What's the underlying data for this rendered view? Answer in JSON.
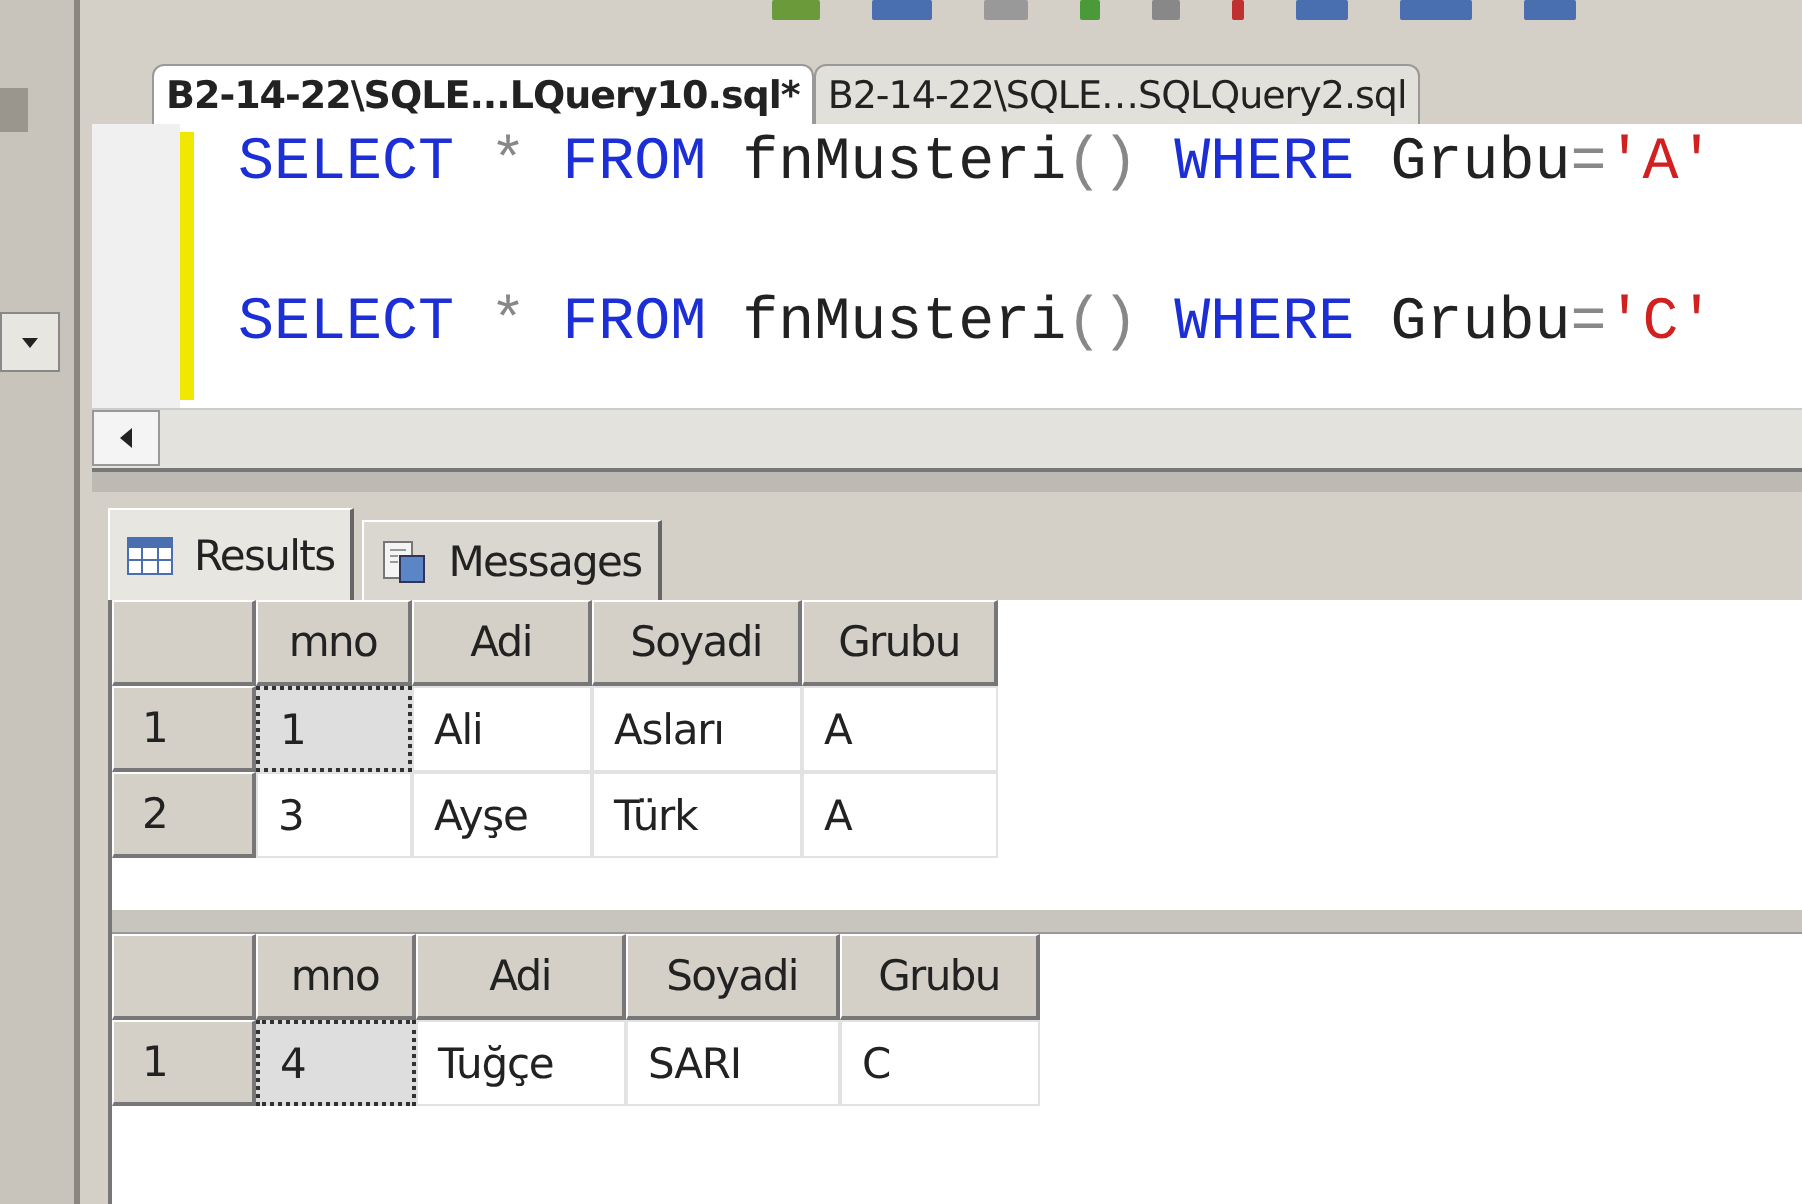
{
  "document_tabs": [
    {
      "label": "B2-14-22\\SQLE...LQuery10.sql*",
      "selected": true
    },
    {
      "label": "B2-14-22\\SQLE…SQLQuery2.sql",
      "selected": false
    }
  ],
  "editor": {
    "lines": [
      {
        "words": [
          {
            "parts": [
              {
                "kind": "keyword",
                "text": "SELECT"
              }
            ]
          },
          {
            "parts": [
              {
                "kind": "operator",
                "text": "*"
              }
            ]
          },
          {
            "parts": [
              {
                "kind": "keyword",
                "text": "FROM"
              }
            ]
          },
          {
            "parts": [
              {
                "kind": "plain",
                "text": "fnMusteri"
              },
              {
                "kind": "operator",
                "text": "()"
              }
            ]
          },
          {
            "parts": [
              {
                "kind": "keyword",
                "text": "WHERE"
              }
            ]
          },
          {
            "parts": [
              {
                "kind": "plain",
                "text": "Grubu"
              },
              {
                "kind": "operator",
                "text": "="
              },
              {
                "kind": "string",
                "text": "'A'"
              }
            ]
          }
        ]
      },
      {
        "words": [
          {
            "parts": [
              {
                "kind": "keyword",
                "text": "SELECT"
              }
            ]
          },
          {
            "parts": [
              {
                "kind": "operator",
                "text": "*"
              }
            ]
          },
          {
            "parts": [
              {
                "kind": "keyword",
                "text": "FROM"
              }
            ]
          },
          {
            "parts": [
              {
                "kind": "plain",
                "text": "fnMusteri"
              },
              {
                "kind": "operator",
                "text": "()"
              }
            ]
          },
          {
            "parts": [
              {
                "kind": "keyword",
                "text": "WHERE"
              }
            ]
          },
          {
            "parts": [
              {
                "kind": "plain",
                "text": "Grubu"
              },
              {
                "kind": "operator",
                "text": "="
              },
              {
                "kind": "string",
                "text": "'C'"
              }
            ]
          }
        ]
      }
    ]
  },
  "result_tabs": [
    {
      "label": "Results",
      "kind": "grid",
      "selected": true
    },
    {
      "label": "Messages",
      "kind": "messages",
      "selected": false
    }
  ],
  "result_sets": [
    {
      "columns": [
        "mno",
        "Adi",
        "Soyadi",
        "Grubu"
      ],
      "rows": [
        {
          "number": "1",
          "cells": [
            {
              "text": "1",
              "selected": true
            },
            {
              "text": "Ali",
              "selected": false
            },
            {
              "text": "Asları",
              "selected": false
            },
            {
              "text": "A",
              "selected": false
            }
          ]
        },
        {
          "number": "2",
          "cells": [
            {
              "text": "3",
              "selected": false
            },
            {
              "text": "Ayşe",
              "selected": false
            },
            {
              "text": "Türk",
              "selected": false
            },
            {
              "text": "A",
              "selected": false
            }
          ]
        }
      ]
    },
    {
      "columns": [
        "mno",
        "Adi",
        "Soyadi",
        "Grubu"
      ],
      "rows": [
        {
          "number": "1",
          "cells": [
            {
              "text": "4",
              "selected": true
            },
            {
              "text": "Tuğçe",
              "selected": false
            },
            {
              "text": "SARI",
              "selected": false
            },
            {
              "text": "C",
              "selected": false
            }
          ]
        }
      ]
    }
  ]
}
